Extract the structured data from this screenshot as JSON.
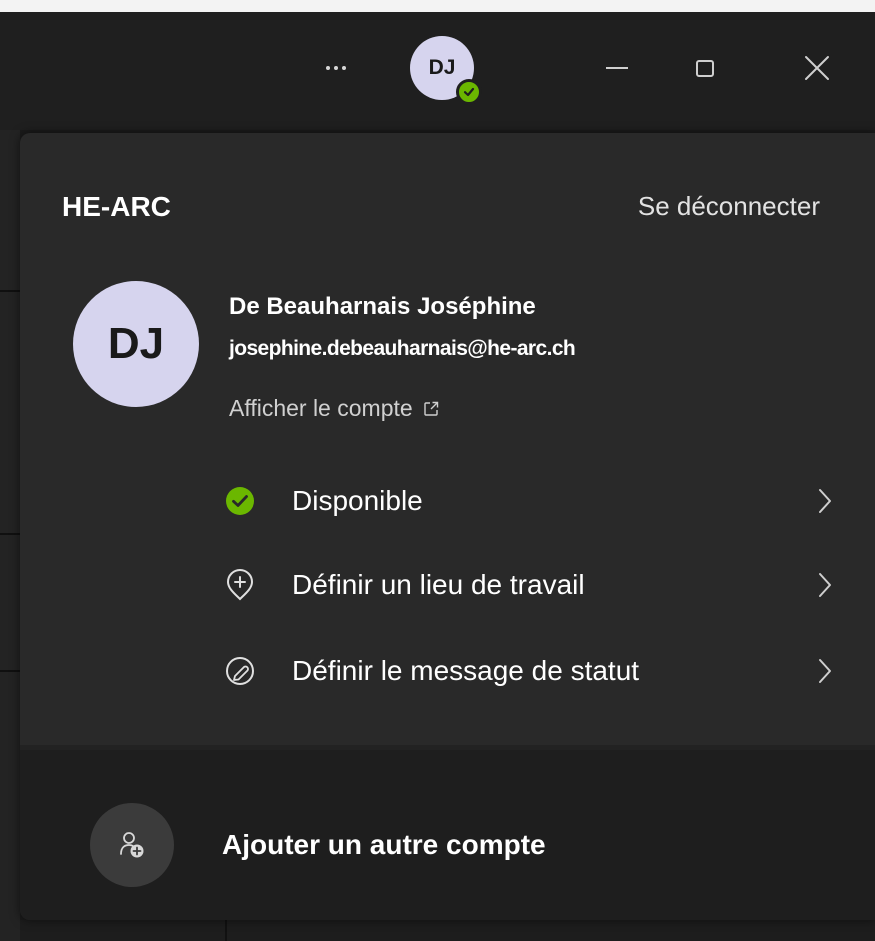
{
  "titlebar": {
    "avatar_initials": "DJ",
    "presence_color": "#6bb700",
    "icons": [
      "more-icon",
      "minimize-icon",
      "maximize-icon",
      "close-icon"
    ]
  },
  "account_panel": {
    "org_name": "HE-ARC",
    "sign_out_label": "Se déconnecter",
    "avatar_initials": "DJ",
    "user_name": "De Beauharnais Joséphine",
    "user_email": "josephine.debeauharnais@he-arc.ch",
    "view_account_label": "Afficher le compte",
    "status_items": [
      {
        "label": "Disponible",
        "icon": "available-check-icon"
      },
      {
        "label": "Définir un lieu de travail",
        "icon": "location-pin-add-icon"
      },
      {
        "label": "Définir le message de statut",
        "icon": "status-message-icon"
      }
    ],
    "add_account_label": "Ajouter un autre compte",
    "add_account_icon": "add-person-icon"
  },
  "colors": {
    "background": "#1b1b1b",
    "panel": "#292929",
    "avatar": "#d6d4ee",
    "available": "#6bb700"
  }
}
